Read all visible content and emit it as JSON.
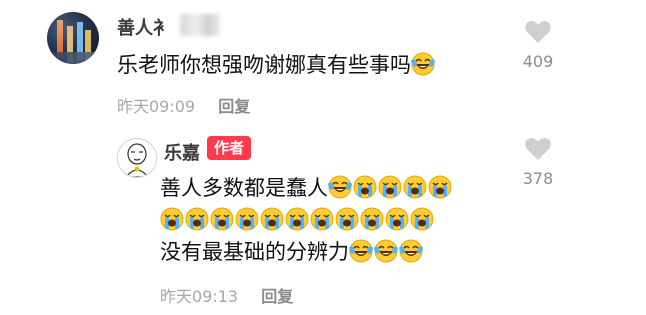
{
  "comment": {
    "username": "善人衤",
    "text": "乐老师你想强吻谢娜真有些事吗",
    "time": "昨天09:09",
    "reply_label": "回复",
    "likes": "409"
  },
  "reply": {
    "username": "乐嘉",
    "badge": "作者",
    "line1_text": "善人多数都是蠢人",
    "line3_text": "没有最基础的分辨力",
    "time": "昨天09:13",
    "reply_label": "回复",
    "likes": "378"
  },
  "icons": {
    "like": "heart-icon",
    "laughing_emoji": "laughing-crying-emoji",
    "crying_emoji": "loudly-crying-emoji"
  },
  "colors": {
    "badge": "#ff3a4b",
    "heart": "#cfcfcf",
    "meta_text": "#a8a8a8"
  }
}
